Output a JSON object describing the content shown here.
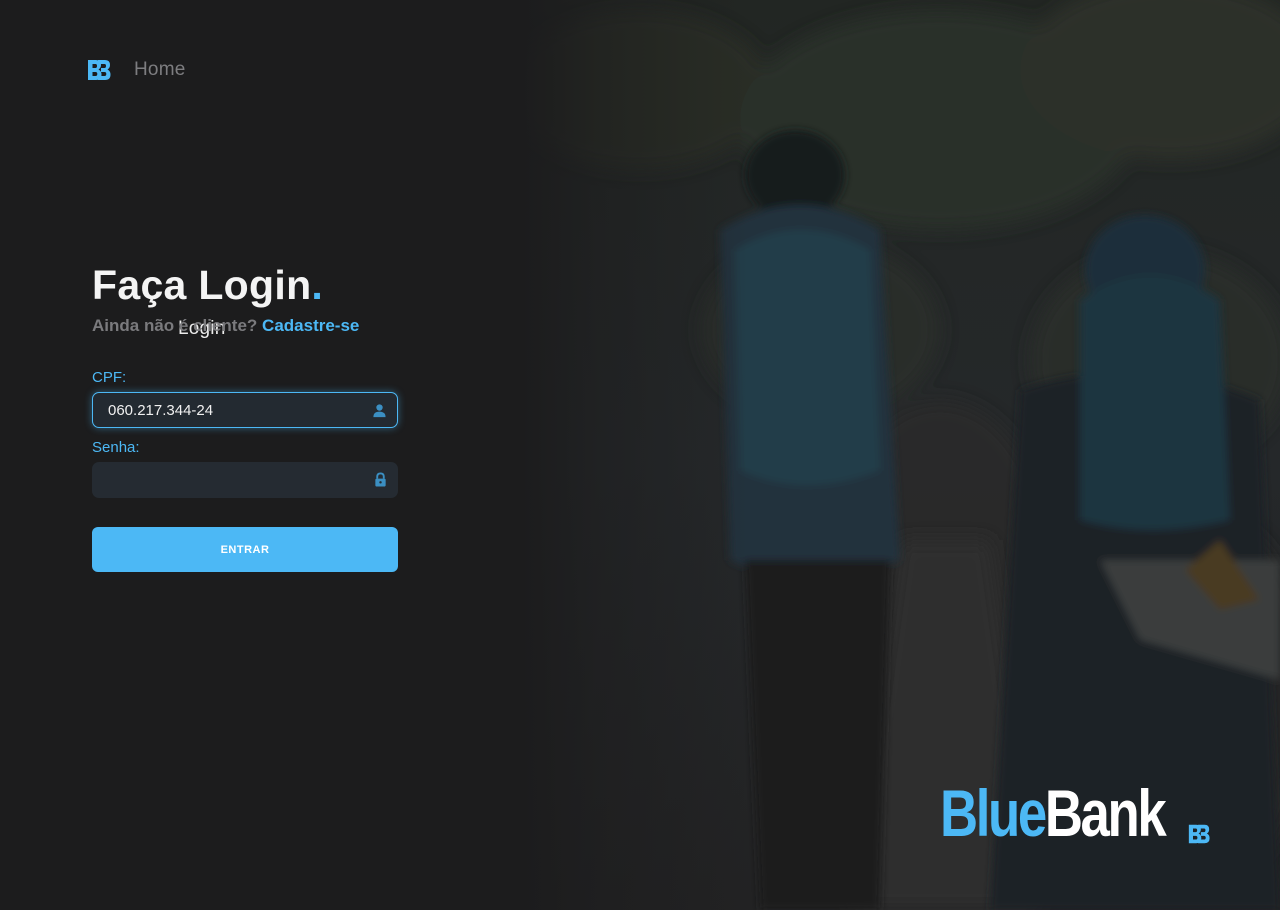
{
  "nav": {
    "logo_icon": "bluebank-logo-icon",
    "home_label": "Home",
    "login_label": "Login"
  },
  "login": {
    "title": "Faça Login",
    "title_dot": ".",
    "subtitle_text": "Ainda não é cliente?",
    "signup_link": "Cadastre-se",
    "cpf_label": "CPF:",
    "cpf_value": "060.217.344-24",
    "cpf_icon": "user-icon",
    "password_label": "Senha:",
    "password_value": "",
    "password_icon": "lock-icon",
    "submit_label": "ENTRAR"
  },
  "brand": {
    "name_part1": "Blue",
    "name_part2": "Bank",
    "mark_icon": "bluebank-logo-icon"
  },
  "colors": {
    "accent": "#4cb8f5",
    "background": "#1c1c1d",
    "input_bg": "#252b32",
    "muted_text": "#7a7a7d"
  }
}
